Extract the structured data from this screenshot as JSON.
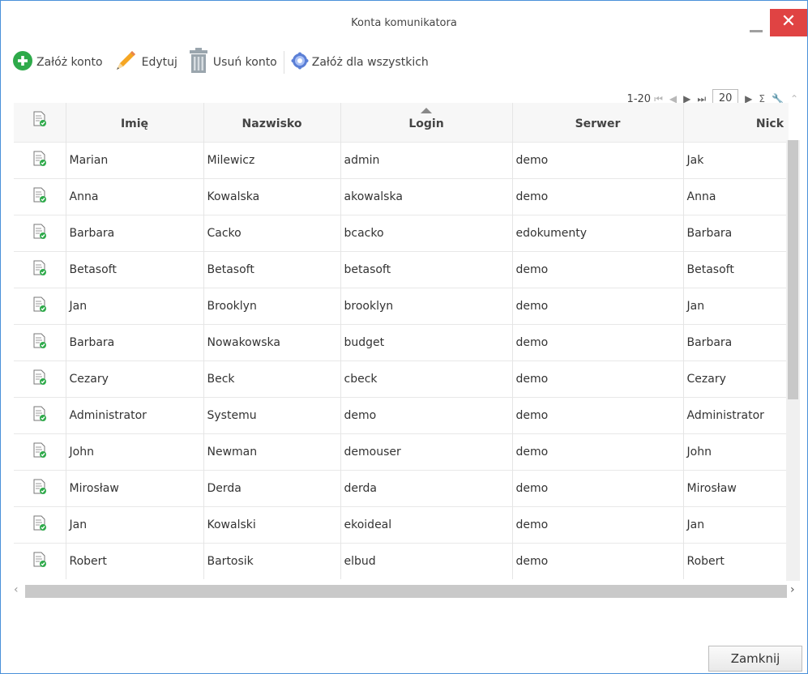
{
  "window": {
    "title": "Konta komunikatora",
    "close_label": "✕"
  },
  "toolbar": {
    "create_label": "Załóż konto",
    "edit_label": "Edytuj",
    "delete_label": "Usuń konto",
    "create_all_label": "Załóż dla wszystkich"
  },
  "pager": {
    "range": "1-20",
    "page_size": "20"
  },
  "columns": [
    "Imię",
    "Nazwisko",
    "Login",
    "Serwer",
    "Nick"
  ],
  "rows": [
    [
      "Marian",
      "Milewicz",
      "admin",
      "demo",
      "Jak"
    ],
    [
      "Anna",
      "Kowalska",
      "akowalska",
      "demo",
      "Anna"
    ],
    [
      "Barbara",
      "Cacko",
      "bcacko",
      "edokumenty",
      "Barbara"
    ],
    [
      "Betasoft",
      "Betasoft",
      "betasoft",
      "demo",
      "Betasoft"
    ],
    [
      "Jan",
      "Brooklyn",
      "brooklyn",
      "demo",
      "Jan"
    ],
    [
      "Barbara",
      "Nowakowska",
      "budget",
      "demo",
      "Barbara"
    ],
    [
      "Cezary",
      "Beck",
      "cbeck",
      "demo",
      "Cezary"
    ],
    [
      "Administrator",
      "Systemu",
      "demo",
      "demo",
      "Administrator"
    ],
    [
      "John",
      "Newman",
      "demouser",
      "demo",
      "John"
    ],
    [
      "Mirosław",
      "Derda",
      "derda",
      "demo",
      "Mirosław"
    ],
    [
      "Jan",
      "Kowalski",
      "ekoideal",
      "demo",
      "Jan"
    ],
    [
      "Robert",
      "Bartosik",
      "elbud",
      "demo",
      "Robert"
    ]
  ],
  "footer": {
    "close_label": "Zamknij"
  },
  "colors": {
    "accent": "#4a90d9",
    "close": "#e04343",
    "create_green": "#2eaa4a"
  }
}
